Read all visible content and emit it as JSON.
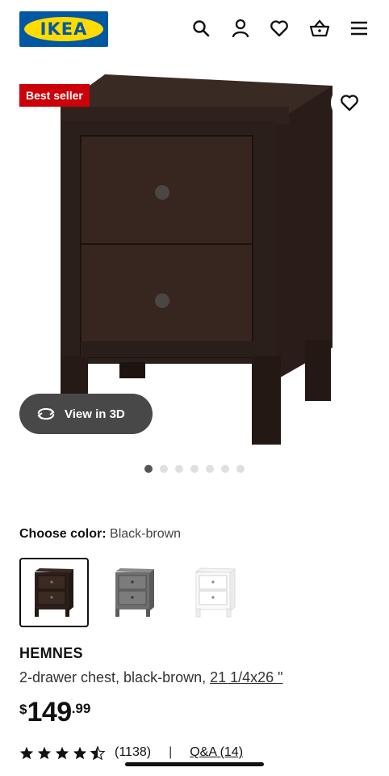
{
  "header": {
    "logo_text": "IKEA",
    "icons": [
      "search-icon",
      "user-icon",
      "heart-icon",
      "basket-icon",
      "menu-icon"
    ]
  },
  "product_image": {
    "badge": "Best seller",
    "view3d_label": "View in 3D",
    "carousel_count": 7,
    "carousel_active": 1
  },
  "color": {
    "label": "Choose color:",
    "value": "Black-brown",
    "options": [
      "Black-brown",
      "Gray",
      "White"
    ],
    "selected": 0
  },
  "product": {
    "name": "HEMNES",
    "desc_prefix": "2-drawer chest, black-brown, ",
    "size": "21 1/4x26 \"",
    "price_currency": "$",
    "price_whole": "149",
    "price_cents": ".99"
  },
  "rating": {
    "stars": 4.5,
    "count": "(1138)",
    "separator": "|",
    "qa_label": "Q&A",
    "qa_count": "(14)"
  },
  "colors": {
    "ikea_blue": "#0058a3",
    "ikea_yellow": "#ffdb00",
    "badge_red": "#cc0008",
    "wood_dark": "#2f211d"
  }
}
